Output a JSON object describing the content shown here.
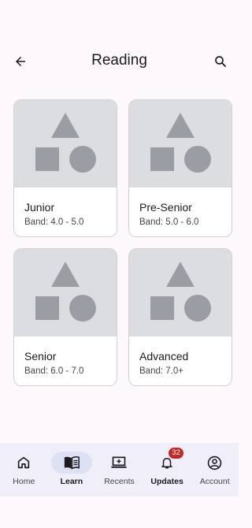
{
  "header": {
    "title": "Reading"
  },
  "icons": {
    "back": "arrow-left-icon",
    "search": "magnifier-icon",
    "placeholder": "shapes-placeholder-icon"
  },
  "cards": [
    {
      "title": "Junior",
      "band": "Band: 4.0 - 5.0"
    },
    {
      "title": "Pre-Senior",
      "band": "Band: 5.0 - 6.0"
    },
    {
      "title": "Senior",
      "band": "Band: 6.0 - 7.0"
    },
    {
      "title": "Advanced",
      "band": "Band: 7.0+"
    }
  ],
  "nav": {
    "items": [
      {
        "label": "Home",
        "icon": "home-icon"
      },
      {
        "label": "Learn",
        "icon": "book-icon",
        "active": true
      },
      {
        "label": "Recents",
        "icon": "laptop-icon"
      },
      {
        "label": "Updates",
        "icon": "bell-icon",
        "badge": "32"
      },
      {
        "label": "Account",
        "icon": "account-circle-icon"
      }
    ]
  },
  "colors": {
    "background": "#fdf8fb",
    "placeholder": "#dcdde0",
    "shape": "#9a9da4",
    "nav_background": "#efeef9",
    "active_pill": "#dde1f5",
    "badge": "#c62828"
  }
}
